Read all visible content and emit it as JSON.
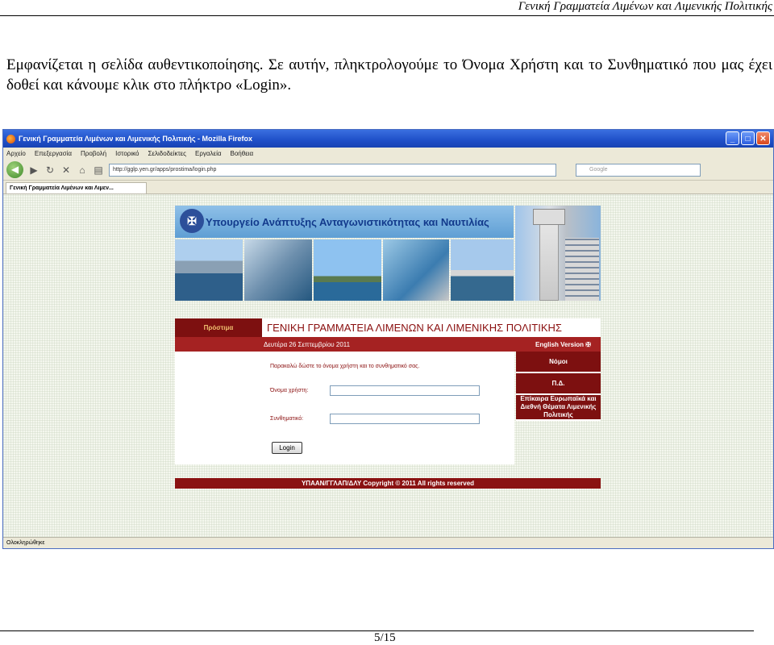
{
  "header": {
    "text": "Γενική Γραμματεία Λιμένων και Λιμενικής Πολιτικής"
  },
  "paragraph": {
    "text": "Εμφανίζεται η σελίδα αυθεντικοποίησης. Σε αυτήν, πληκτρολογούμε το Όνομα Χρήστη και το Συνθηματικό που μας έχει δοθεί και κάνουμε κλικ στο πλήκτρο «Login»."
  },
  "footer": {
    "page": "5/15"
  },
  "browser": {
    "title": "Γενική Γραμματεία Λιμένων και Λιμενικής Πολιτικής - Mozilla Firefox",
    "menu": [
      "Αρχείο",
      "Επεξεργασία",
      "Προβολή",
      "Ιστορικό",
      "Σελιδοδείκτες",
      "Εργαλεία",
      "Βοήθεια"
    ],
    "url": "http://gglp.yen.gr/apps/prostima/login.php",
    "search_placeholder": "Google",
    "tab": "Γενική Γραμματεία Λιμένων και Λιμεν...",
    "status": "Ολοκληρώθηκε"
  },
  "site": {
    "ministry": "Υπουργείο Ανάπτυξης Ανταγωνιστικότητας και Ναυτιλίας",
    "home": "Πρόστιμα",
    "title": "ΓΕΝΙΚΗ ΓΡΑΜΜΑΤΕΙΑ ΛΙΜΕΝΩΝ ΚΑΙ ΛΙΜΕΝΙΚΗΣ ΠΟΛΙΤΙΚΗΣ",
    "date": "Δευτέρα 26 Σεπτεμβρίου 2011",
    "english": "English Version",
    "prompt": "Παρακαλώ δώστε το όνομα χρήστη και το συνθηματικό σας.",
    "username_label": "Όνομα χρήστη:",
    "password_label": "Συνθηματικό:",
    "login": "Login",
    "side": [
      "Νόμοι",
      "Π.Δ.",
      "Επίκαιρα Ευρωπαϊκά και Διεθνή Θέματα Λιμενικής Πολιτικής"
    ],
    "copyright": "ΥΠΑΑΝ/ΓΓΛΑΠ/ΔΛΥ Copyright © 2011 All rights reserved"
  }
}
